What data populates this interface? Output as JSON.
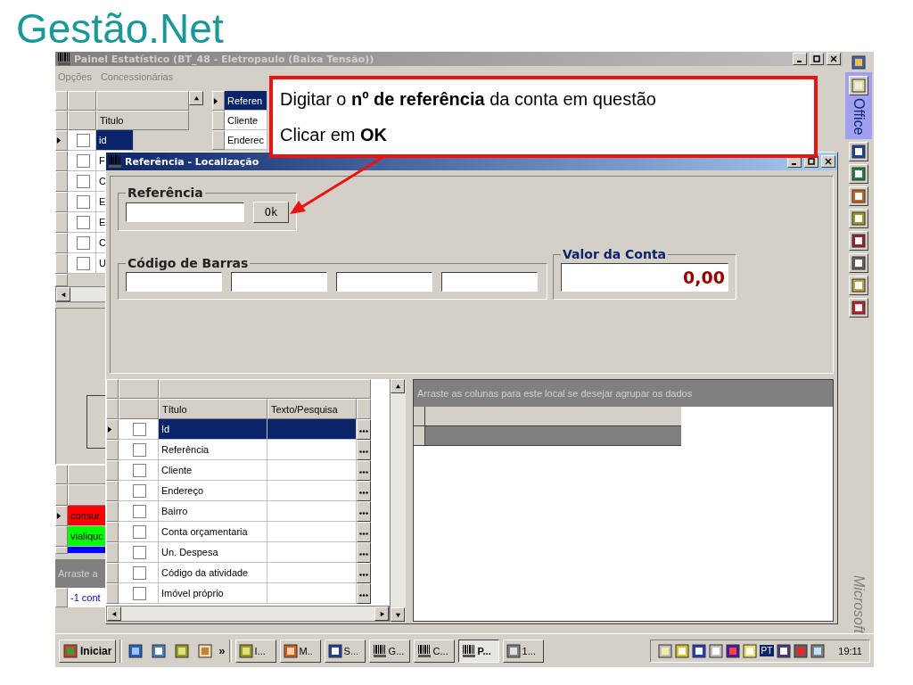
{
  "slide": {
    "title": "Gestão.Net"
  },
  "main_window": {
    "title": "Painel Estatístico (BT_48 - Eletropaulo (Baixa Tensão))",
    "menu": [
      "Opções",
      "Concessionárias"
    ],
    "left_grid": {
      "header": "Titulo",
      "rows": [
        {
          "text": "id",
          "checked": false,
          "selected": true
        },
        {
          "text": "F",
          "checked": false,
          "selected": false
        },
        {
          "text": "C",
          "checked": false,
          "selected": false
        },
        {
          "text": "E",
          "checked": false,
          "selected": false
        },
        {
          "text": "E",
          "checked": false,
          "selected": false
        },
        {
          "text": "C",
          "checked": false,
          "selected": false
        },
        {
          "text": "U",
          "checked": false,
          "selected": false
        }
      ]
    },
    "field_grid": {
      "rows": [
        {
          "text": "Referen",
          "selected": true
        },
        {
          "text": "Cliente",
          "selected": false
        },
        {
          "text": "Enderec",
          "selected": false
        }
      ]
    },
    "legend_grid": {
      "rows": [
        {
          "text": "consur",
          "color": "#ff0000",
          "selected": true
        },
        {
          "text": "vialiquc",
          "color": "#00ff00",
          "selected": false
        },
        {
          "color": "#0000ff",
          "selected": false
        }
      ]
    },
    "group_panel": {
      "hint": "Arraste a",
      "rows": [
        "-1 cont"
      ]
    }
  },
  "dialog": {
    "title": "Referência - Localização",
    "referencia": {
      "label": "Referência",
      "button": "Ok"
    },
    "codigo": {
      "label": "Código de Barras"
    },
    "valor": {
      "label": "Valor da Conta",
      "value": "0,00"
    },
    "grid": {
      "columns": [
        "Título",
        "Texto/Pesquisa"
      ],
      "rows": [
        {
          "title": "Id",
          "checked": false,
          "selected": true
        },
        {
          "title": "Referência",
          "checked": false,
          "selected": false
        },
        {
          "title": "Cliente",
          "checked": false,
          "selected": false
        },
        {
          "title": "Endereço",
          "checked": false,
          "selected": false
        },
        {
          "title": "Bairro",
          "checked": false,
          "selected": false
        },
        {
          "title": "Conta orçamentaria",
          "checked": false,
          "selected": false
        },
        {
          "title": "Un. Despesa",
          "checked": false,
          "selected": false
        },
        {
          "title": "Código da atividade",
          "checked": false,
          "selected": false
        },
        {
          "title": "Imóvel próprio",
          "checked": false,
          "selected": false
        }
      ]
    },
    "group_area": {
      "hint": "Arraste as colunas para este local se desejar agrupar os dados"
    }
  },
  "office_bar": {
    "title": "Office",
    "footer": "Microsoft"
  },
  "taskbar": {
    "start": "Iniciar",
    "more": "»",
    "tasks": [
      {
        "label": "I...",
        "kind": "clock",
        "selected": false
      },
      {
        "label": "M..",
        "kind": "slide",
        "selected": false
      },
      {
        "label": "S...",
        "kind": "word",
        "selected": false
      },
      {
        "label": "G...",
        "kind": "barcode",
        "selected": false
      },
      {
        "label": "C...",
        "kind": "barcode",
        "selected": false
      },
      {
        "label": "P...",
        "kind": "barcode",
        "selected": true
      },
      {
        "label": "1...",
        "kind": "tool",
        "selected": false
      }
    ],
    "language": "PT",
    "clock": "19:11"
  },
  "callout": {
    "lines": [
      "Digitar o **nº de referência** da conta em questão",
      "Clicar em **OK**"
    ]
  }
}
